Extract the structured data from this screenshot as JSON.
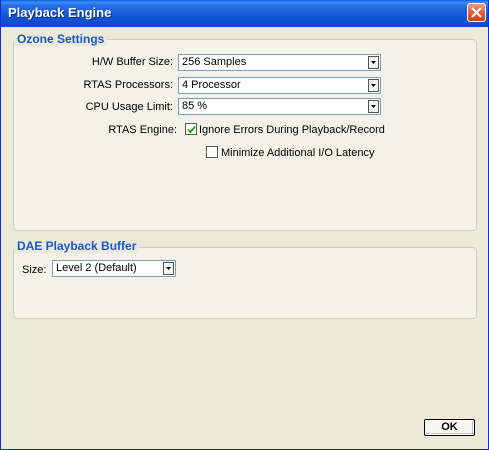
{
  "window": {
    "title": "Playback Engine"
  },
  "ozone": {
    "title": "Ozone Settings",
    "hw_buffer": {
      "label": "H/W Buffer Size:",
      "value": "256 Samples"
    },
    "rtas_processors": {
      "label": "RTAS Processors:",
      "value": "4 Processor"
    },
    "cpu_usage": {
      "label": "CPU Usage Limit:",
      "value": "85 %"
    },
    "rtas_engine": {
      "label": "RTAS Engine:",
      "ignore_errors": {
        "label": "Ignore Errors During Playback/Record",
        "checked": true
      },
      "minimize_latency": {
        "label": "Minimize Additional I/O Latency",
        "checked": false
      }
    }
  },
  "dae": {
    "title": "DAE Playback Buffer",
    "size": {
      "label": "Size:",
      "value": "Level 2 (Default)"
    }
  },
  "ok_label": "OK",
  "colors": {
    "titlebar": "#1458d8",
    "group_title": "#1c57c6",
    "close_button": "#e3613c",
    "checkmark": "#21a121"
  },
  "icons": {
    "close": "close-icon",
    "dropdown": "chevron-down-icon",
    "check": "checkmark-icon"
  }
}
